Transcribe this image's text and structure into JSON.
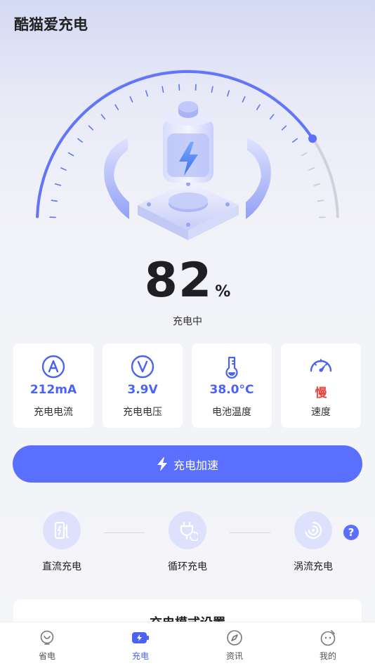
{
  "app": {
    "title": "酷猫爱充电"
  },
  "battery": {
    "percent": "82",
    "unit": "%",
    "status": "充电中",
    "level": 0.82
  },
  "stats": [
    {
      "icon": "ampere-icon",
      "value": "212mA",
      "label": "充电电流",
      "color": "#4a63f3"
    },
    {
      "icon": "voltage-icon",
      "value": "3.9V",
      "label": "充电电压",
      "color": "#4a63f3"
    },
    {
      "icon": "thermometer-icon",
      "value": "38.0°C",
      "label": "电池温度",
      "color": "#4a63f3"
    },
    {
      "icon": "speedometer-icon",
      "value": "慢",
      "label": "速度",
      "color": "#e8453c"
    }
  ],
  "boost": {
    "label": "充电加速",
    "icon": "lightning-icon"
  },
  "modes": [
    {
      "icon": "dc-charge-icon",
      "label": "直流充电"
    },
    {
      "icon": "cycle-charge-icon",
      "label": "循环充电"
    },
    {
      "icon": "vortex-charge-icon",
      "label": "涡流充电"
    }
  ],
  "help": {
    "glyph": "?"
  },
  "settings": {
    "title": "充电模式设置"
  },
  "tabs": [
    {
      "icon": "bulb-icon",
      "label": "省电",
      "active": false
    },
    {
      "icon": "battery-bolt-icon",
      "label": "充电",
      "active": true
    },
    {
      "icon": "compass-icon",
      "label": "资讯",
      "active": false
    },
    {
      "icon": "face-icon",
      "label": "我的",
      "active": false
    }
  ],
  "colors": {
    "accent": "#5b6ffe",
    "accent_text": "#4a63f3",
    "slow": "#e8453c"
  }
}
